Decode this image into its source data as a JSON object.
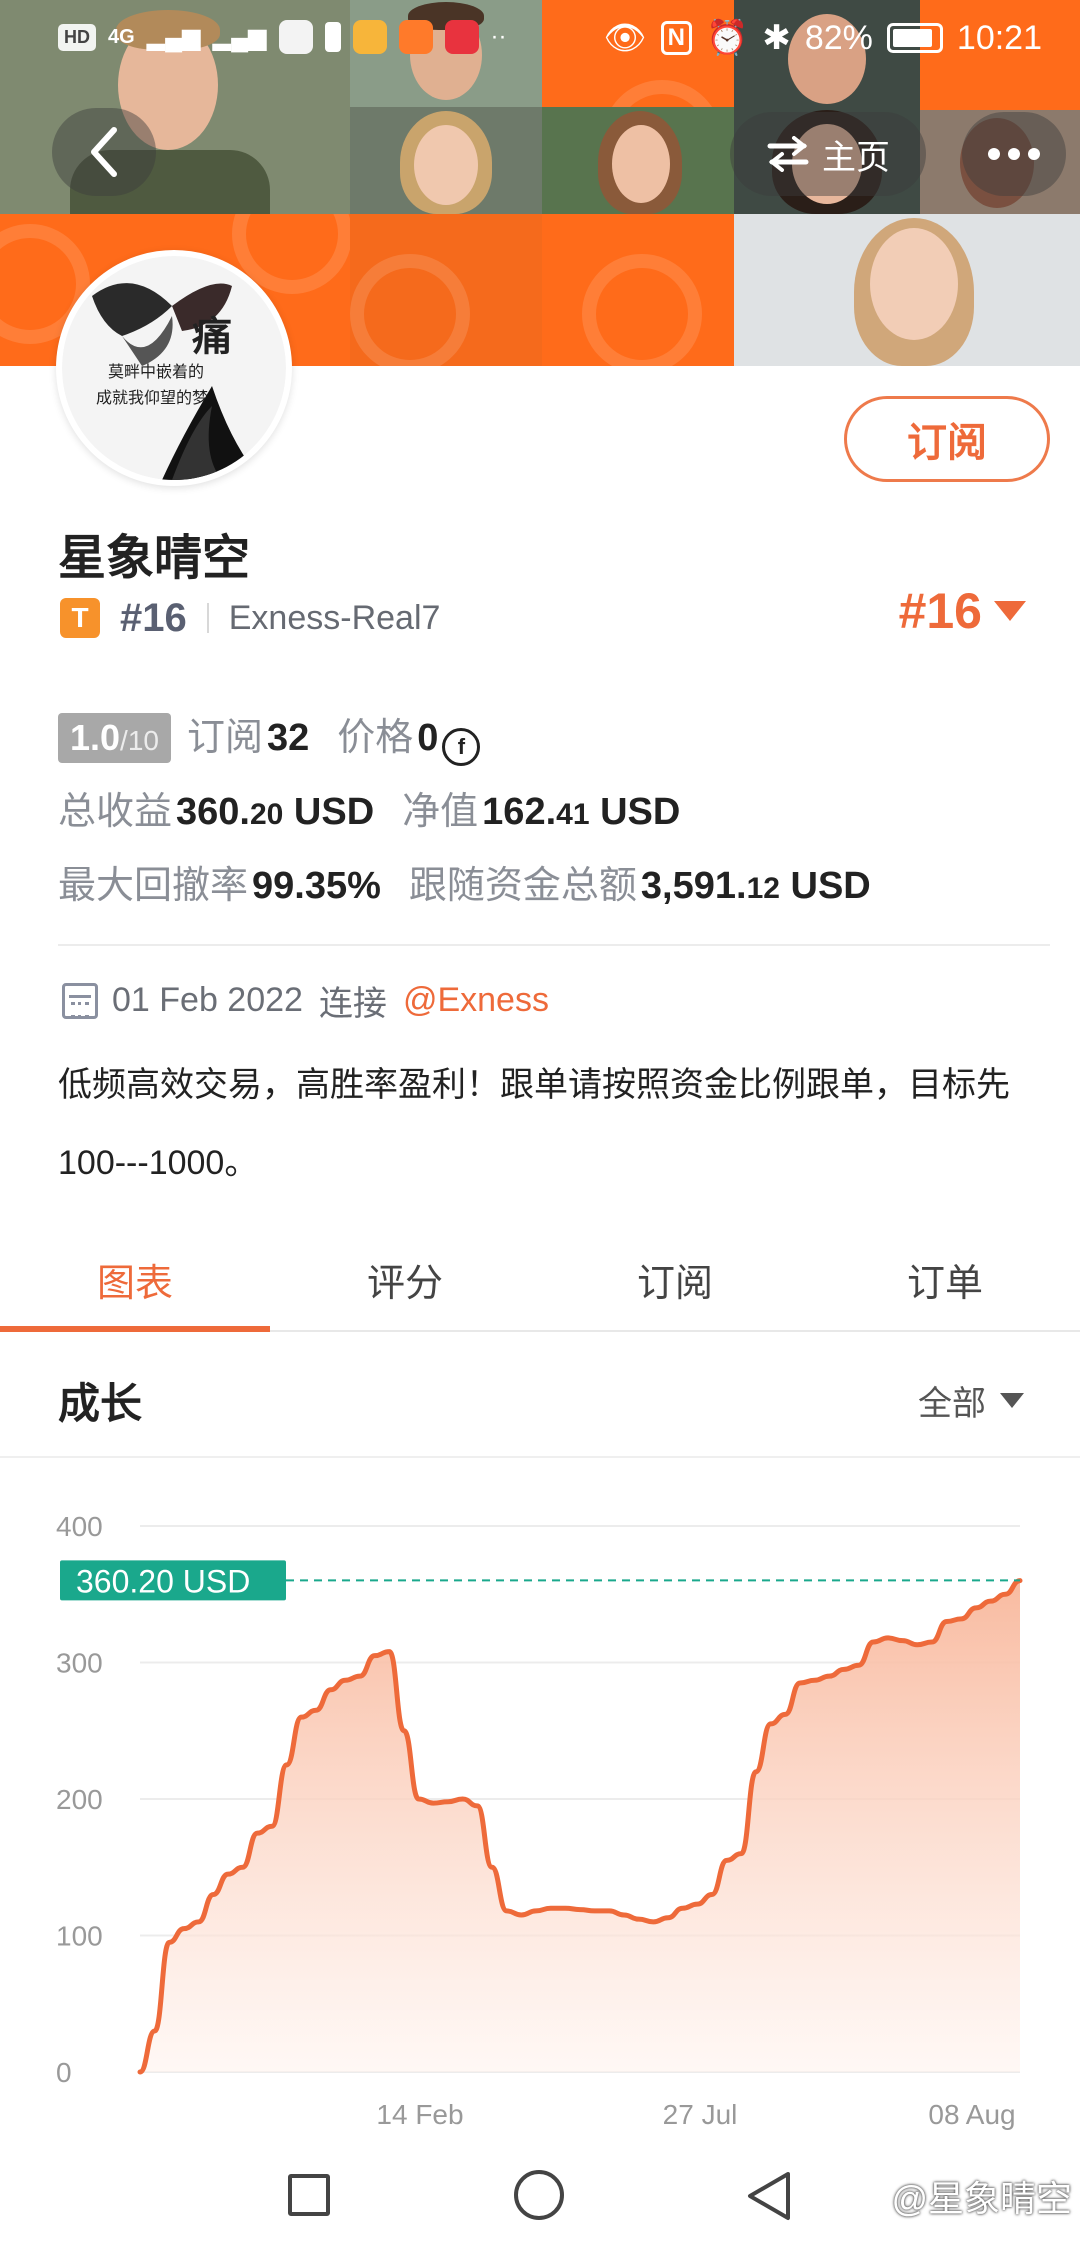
{
  "status_bar": {
    "hd_label": "HD",
    "network_label": "4G",
    "battery_percent": "82%",
    "time": "10:21"
  },
  "header": {
    "home_label": "主页"
  },
  "profile": {
    "subscribe_label": "订阅",
    "name": "星象晴空",
    "badge_letter": "T",
    "rank": "#16",
    "broker_account": "Exness-Real7",
    "rank_big": "#16",
    "avatar_caption_1": "痛",
    "avatar_caption_2": "莫畔中嵌着的",
    "avatar_caption_3": "成就我仰望的梦"
  },
  "stats": {
    "score": "1.0",
    "score_max": "/10",
    "subscribe_label": "订阅",
    "subscribe_count": "32",
    "price_label": "价格",
    "price_value": "0",
    "coin_symbol": "f",
    "total_profit_label": "总收益",
    "total_profit_int": "360.",
    "total_profit_dec": "20",
    "total_profit_unit": "USD",
    "equity_label": "净值",
    "equity_int": "162.",
    "equity_dec": "41",
    "equity_unit": "USD",
    "max_drawdown_label": "最大回撤率",
    "max_drawdown_value": "99.35%",
    "follow_funds_label": "跟随资金总额",
    "follow_funds_int": "3,591.",
    "follow_funds_dec": "12",
    "follow_funds_unit": "USD"
  },
  "join": {
    "date": "01 Feb 2022",
    "connect_label": "连接",
    "broker": "@Exness"
  },
  "description": "低频高效交易，高胜率盈利！跟单请按照资金比例跟单，目标先100---1000。",
  "tabs": [
    {
      "label": "图表",
      "active": true
    },
    {
      "label": "评分",
      "active": false
    },
    {
      "label": "订阅",
      "active": false
    },
    {
      "label": "订单",
      "active": false
    }
  ],
  "section": {
    "title": "成长",
    "filter_label": "全部"
  },
  "chart_data": {
    "type": "area",
    "title": "成长",
    "xlabel": "",
    "ylabel": "",
    "ylim": [
      0,
      400
    ],
    "yticks": [
      "0",
      "100",
      "200",
      "300",
      "400"
    ],
    "xticks": [
      "14 Feb",
      "27 Jul",
      "08 Aug"
    ],
    "current_value_label": "360.20 USD",
    "current_value": 360.2,
    "series": [
      {
        "values": [
          0,
          30,
          95,
          105,
          110,
          130,
          145,
          150,
          175,
          180,
          225,
          260,
          265,
          280,
          287,
          290,
          305,
          308,
          250,
          200,
          197,
          198,
          200,
          195,
          150,
          118,
          115,
          118,
          120,
          120,
          119,
          118,
          118,
          115,
          112,
          110,
          113,
          120,
          123,
          130,
          155,
          160,
          220,
          255,
          262,
          285,
          287,
          290,
          295,
          298,
          315,
          318,
          316,
          313,
          315,
          330,
          332,
          340,
          345,
          350,
          360
        ]
      }
    ],
    "colors": {
      "line": "#ee6a3a",
      "fill_top": "#f8b79b",
      "fill_bottom": "#fff3ee",
      "marker": "#1aa88c"
    }
  },
  "watermark": "@星象晴空"
}
